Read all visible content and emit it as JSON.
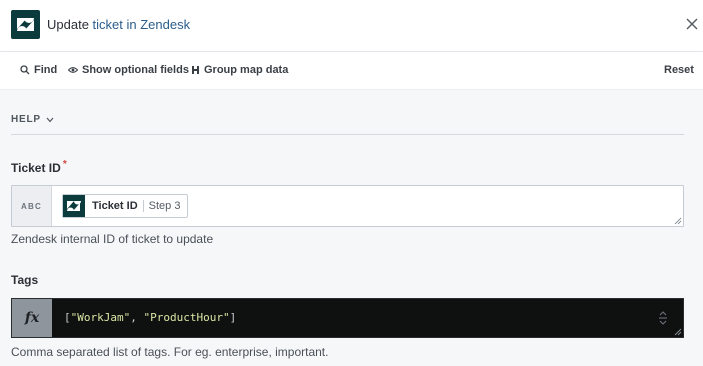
{
  "header": {
    "title_prefix": "Update",
    "title_link": "ticket in Zendesk",
    "app_icon": "zendesk-logo"
  },
  "toolbar": {
    "find": "Find",
    "show_optional": "Show optional fields",
    "group_map": "Group map data",
    "reset": "Reset"
  },
  "help": {
    "label": "HELP"
  },
  "fields": {
    "ticket_id": {
      "label": "Ticket ID",
      "required_mark": "*",
      "type_badge": "ABC",
      "pill_label": "Ticket ID",
      "pill_step": "Step 3",
      "hint": "Zendesk internal ID of ticket to update"
    },
    "tags": {
      "label": "Tags",
      "type_badge": "fx",
      "formula_open": "[",
      "formula_item1": "\"WorkJam\"",
      "formula_sep": ", ",
      "formula_item2": "\"ProductHour\"",
      "formula_close": "]",
      "hint": "Comma separated list of tags. For eg. enterprise, important."
    }
  },
  "colors": {
    "brand_dark": "#0b3b3c",
    "link": "#2a5d8c",
    "required": "#d0463d",
    "code_bg": "#0f1111",
    "code_string": "#d8e6a3"
  }
}
